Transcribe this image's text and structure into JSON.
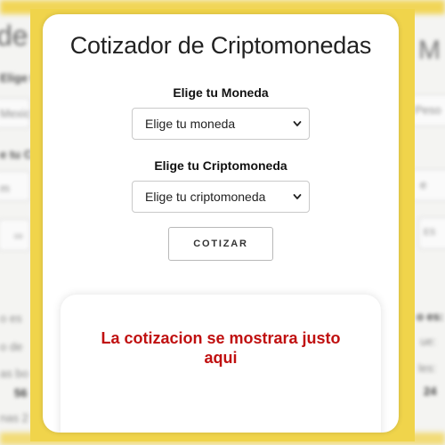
{
  "app": {
    "title": "Cotizador de Criptomonedas"
  },
  "form": {
    "moneda_label": "Elige tu Moneda",
    "moneda_selected": "Elige tu moneda",
    "cripto_label": "Elige tu Criptomoneda",
    "cripto_selected": "Elige tu criptomoneda",
    "submit_label": "COTIZAR"
  },
  "result": {
    "message": "La cotizacion se mostrara justo aqui"
  },
  "background": {
    "fragments_left": [
      "de",
      "Elige t",
      "Mexic",
      "e tu C",
      "m",
      "co",
      "o es",
      "o de",
      "as bo",
      "56",
      "nas 2"
    ],
    "fragments_right": [
      "M",
      "Peso",
      "e",
      "ES",
      "o es:",
      "ue:",
      "les:",
      "24"
    ]
  },
  "colors": {
    "frame": "#f0d44b",
    "accent_text": "#c01010",
    "card_bg": "#ffffff"
  },
  "icons": {
    "select_chevron": "chevron-down-icon"
  }
}
